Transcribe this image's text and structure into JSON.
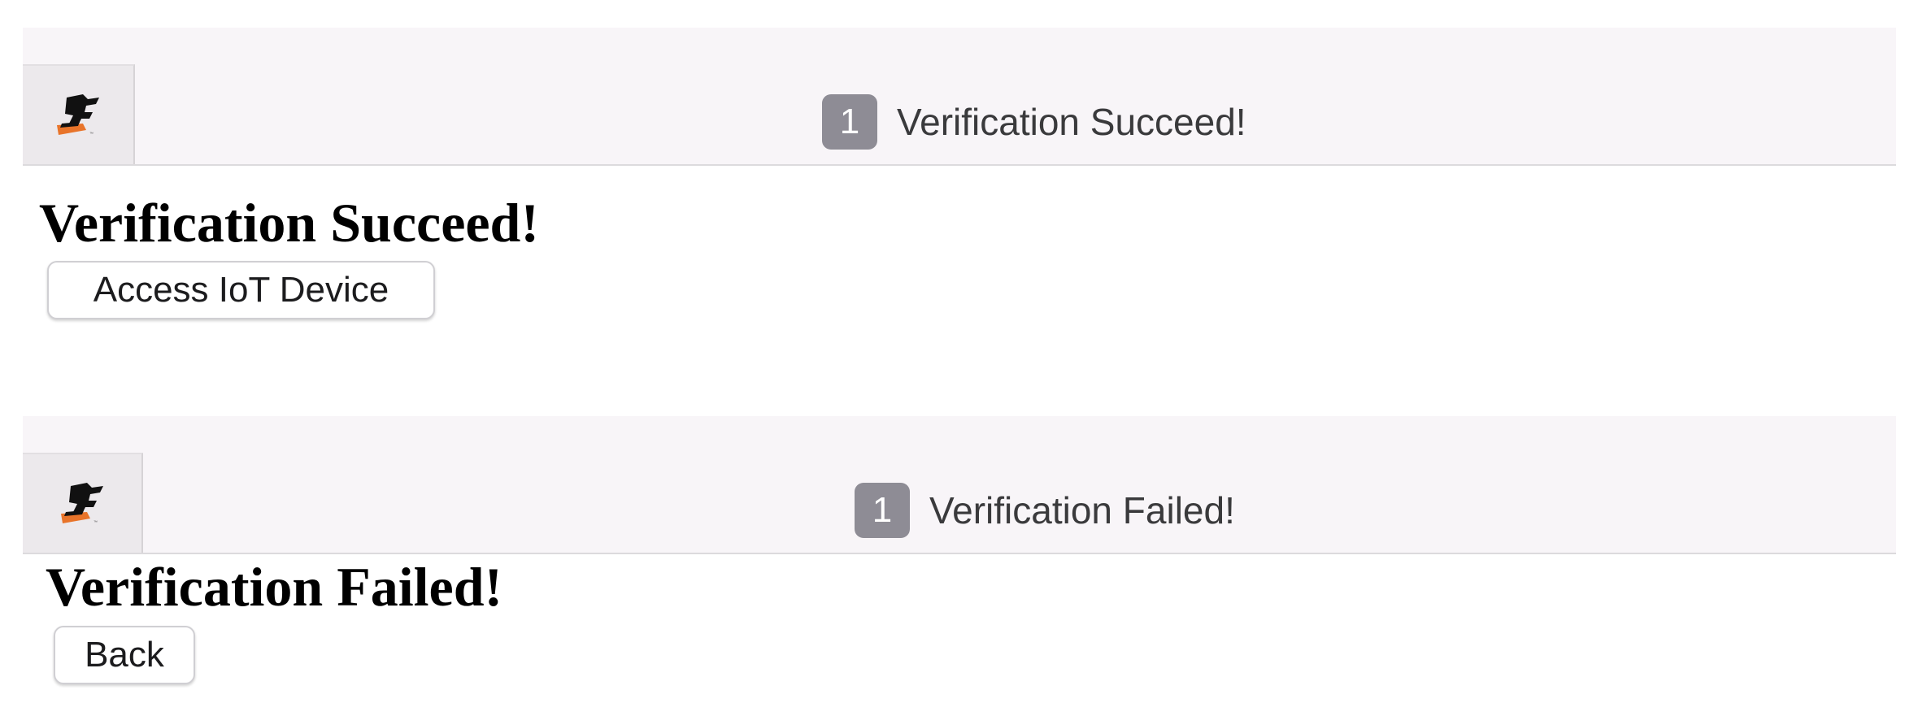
{
  "success_view": {
    "tab": {
      "badge_count": "1",
      "title": "Verification Succeed!"
    },
    "heading": "Verification Succeed!",
    "button_label": "Access IoT Device"
  },
  "failed_view": {
    "tab": {
      "badge_count": "1",
      "title": "Verification Failed!"
    },
    "heading": "Verification Failed!",
    "button_label": "Back"
  },
  "colors": {
    "tab_bar_bg": "#f8f5f8",
    "badge_bg": "#8e8c95",
    "logo_accent": "#e8742a"
  },
  "icons": {
    "app_logo": "app-logo-icon"
  }
}
